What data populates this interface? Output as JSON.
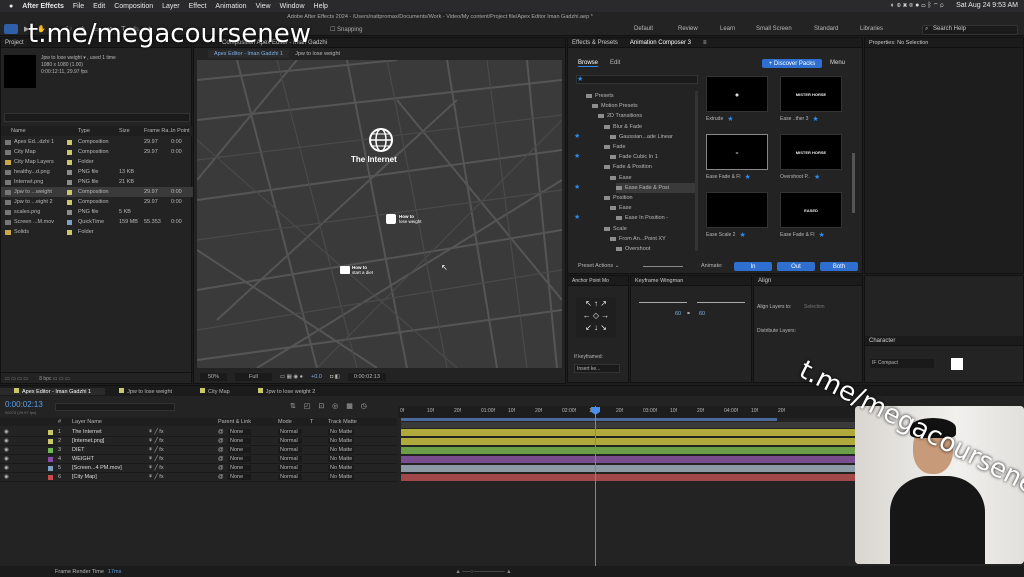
{
  "menubar": {
    "app": "After Effects",
    "items": [
      "File",
      "Edit",
      "Composition",
      "Layer",
      "Effect",
      "Animation",
      "View",
      "Window",
      "Help"
    ],
    "doc_title": "Adobe After Effects 2024 - /Users/nattpromax/Documents/Work - Video/My content/Project file/Apex Editor Iman Gadzhi.aep *",
    "clock": "Sat Aug 24  9:53 AM"
  },
  "toolbar": {
    "snapping": "Snapping",
    "workspaces": [
      "Default",
      "Review",
      "Learn",
      "Small Screen",
      "Standard",
      "Libraries"
    ],
    "search_placeholder": "Search Help"
  },
  "watermark": "t.me/megacoursenew",
  "project": {
    "tab": "Project",
    "info": [
      "Jpw to lose weight ▾ , used 1 time",
      "1080 x 1080 (1.00)",
      "0:00:12:11, 29.97 fps"
    ],
    "columns": [
      "Name",
      "Type",
      "Size",
      "Frame Ra...",
      "In Point"
    ],
    "items": [
      {
        "name": "Apex Ed...dzhi 1",
        "type": "Composition",
        "size": "",
        "fps": "29.97",
        "in": "0:00",
        "color": "#c9c96a"
      },
      {
        "name": "City Map",
        "type": "Composition",
        "size": "",
        "fps": "29.97",
        "in": "0:00",
        "color": "#c9c96a"
      },
      {
        "name": "City Map Layers",
        "type": "Folder",
        "size": "",
        "fps": "",
        "in": "",
        "color": "#c9c96a"
      },
      {
        "name": "healthy...d.png",
        "type": "PNG file",
        "size": "13 KB",
        "fps": "",
        "in": "",
        "color": "#8d8d8d"
      },
      {
        "name": "Internet.png",
        "type": "PNG file",
        "size": "21 KB",
        "fps": "",
        "in": "",
        "color": "#8d8d8d"
      },
      {
        "name": "Jpw to ...weight",
        "type": "Composition",
        "size": "",
        "fps": "29.97",
        "in": "0:00",
        "color": "#c9c96a"
      },
      {
        "name": "Jpw to ...eight 2",
        "type": "Composition",
        "size": "",
        "fps": "29.97",
        "in": "0:00",
        "color": "#c9c96a"
      },
      {
        "name": "scales.png",
        "type": "PNG file",
        "size": "5 KB",
        "fps": "",
        "in": "",
        "color": "#8d8d8d"
      },
      {
        "name": "Screen ...M.mov",
        "type": "QuickTime",
        "size": "159 MB",
        "fps": "55.353",
        "in": "0:00",
        "color": "#7aa0c4"
      },
      {
        "name": "Solids",
        "type": "Folder",
        "size": "",
        "fps": "",
        "in": "",
        "color": "#c9c96a"
      }
    ],
    "bpc": "8 bpc"
  },
  "viewer": {
    "tab": "Composition Apex Editor - Iman Gadzhi",
    "subtabs": [
      "Apex Editor - Iman Gadzhi 1",
      "Jpw to lose weight"
    ],
    "globe_label": "The Internet",
    "card1": [
      "How to",
      "lose weight"
    ],
    "card2": [
      "How to",
      "start a diet"
    ],
    "zoom": "50%",
    "res": "Full",
    "exposure": "+0.0",
    "time": "0:00:02:13"
  },
  "effects": {
    "tabs": [
      "Effects & Presets",
      "Animation Composer 3"
    ],
    "browse": "Browse",
    "edit": "Edit",
    "discover": "+ Discover Packs",
    "menu": "Menu",
    "tree": [
      "Presets",
      "Motion Presets",
      "2D Transitions",
      "Blur & Fade",
      "Gaussian...ade Linear",
      "Fade",
      "Fade Cubic In 1",
      "Fade & Position",
      "Ease",
      "Ease Fade & Posi",
      "Position",
      "Ease",
      "Ease In Position -",
      "Scale",
      "From An...Point XY",
      "Overshoot"
    ],
    "thumbs": [
      {
        "label": "Extrude",
        "art": "◉"
      },
      {
        "label": "Ease ..ther 3",
        "art": "MISTER HORSE"
      },
      {
        "label": "Ease Fade & Fl",
        "art": "••"
      },
      {
        "label": "Overshoot P..",
        "art": "MISTER HORSE"
      },
      {
        "label": "Ease Scale 2",
        "art": ""
      },
      {
        "label": "Ease Fade & Fl",
        "art": "EASED"
      }
    ],
    "preset_actions": "Preset Actions",
    "animate": "Animate:",
    "in": "In",
    "out": "Out",
    "both": "Both"
  },
  "properties": {
    "title": "Properties: No Selection"
  },
  "anchor": {
    "title": "Anchor Point Mo",
    "if_keyframed": "If keyframed:",
    "insert": "Insert ke..."
  },
  "keyframe": {
    "title": "Keyframe Wingman",
    "left": "60",
    "right": "60"
  },
  "align": {
    "title": "Align",
    "align_to": "Align Layers to:",
    "selection": "Selection",
    "distribute": "Distribute Layers:"
  },
  "character": {
    "title": "Character",
    "font": "IF Compact"
  },
  "timeline": {
    "tabs": [
      "Apex Editor - Iman Gadzhi 1",
      "Jpw to lose weight",
      "City Map",
      "Jpw to lose weight 2"
    ],
    "timecode": "0:00:02:13",
    "fps": "00073 (29.97 fps)",
    "headers": [
      "#",
      "Layer Name",
      "Parent & Link",
      "Mode",
      "T",
      "Track Matte"
    ],
    "layers": [
      {
        "n": "1",
        "name": "The Internet",
        "color": "#c9c96a",
        "bar": "#b0a93c"
      },
      {
        "n": "2",
        "name": "[Internet.png]",
        "color": "#c9c96a",
        "bar": "#b0a93c"
      },
      {
        "n": "3",
        "name": "DIET",
        "color": "#6fb84f",
        "bar": "#6c9e47"
      },
      {
        "n": "4",
        "name": "WEIGHT",
        "color": "#8b4aa8",
        "bar": "#7a4d8f"
      },
      {
        "n": "5",
        "name": "[Screen...4 PM.mov]",
        "color": "#7aa0c4",
        "bar": "#8d9aa6"
      },
      {
        "n": "6",
        "name": "[City Map]",
        "color": "#c94a4a",
        "bar": "#a24848"
      }
    ],
    "parent": "None",
    "mode": "Normal",
    "matte": "No Matte",
    "ruler": [
      "0f",
      "10f",
      "20f",
      "01:00f",
      "10f",
      "20f",
      "02:00f",
      "10f",
      "20f",
      "03:00f",
      "10f",
      "20f",
      "04:00f",
      "10f",
      "20f"
    ],
    "footer_label": "Frame Render Time",
    "footer_value": "17ms"
  }
}
